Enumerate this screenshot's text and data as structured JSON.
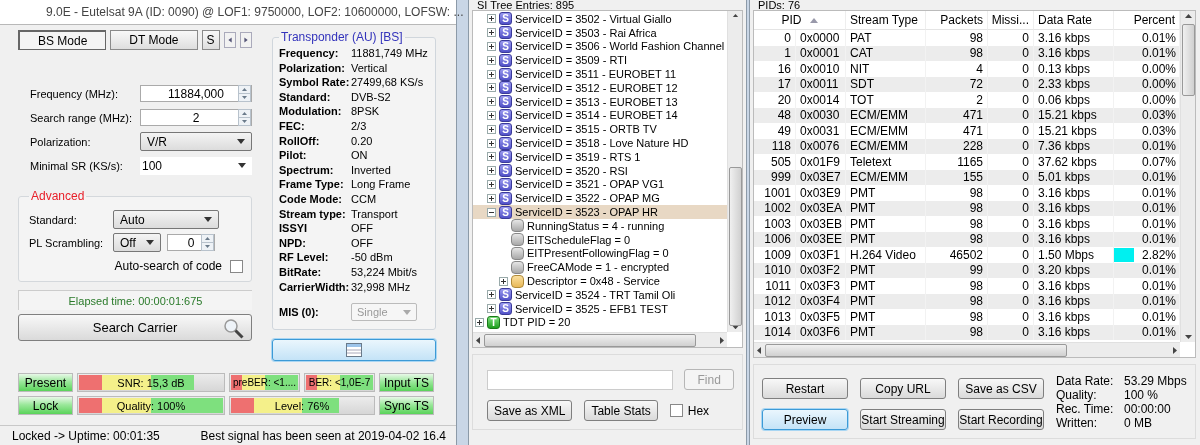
{
  "header": {
    "title": "9.0E - Eutelsat 9A (ID: 0090) @ LOF1: 9750000, LOF2: 10600000, LOFSW: ..."
  },
  "mode_tabs": [
    {
      "label": "BS Mode",
      "selected": true
    },
    {
      "label": "DT Mode",
      "selected": false
    },
    {
      "label": "S",
      "selected": false
    }
  ],
  "tuning_fields": [
    {
      "kind": "spin",
      "label": "Frequency (MHz):",
      "value": "11884,000"
    },
    {
      "kind": "spin",
      "label": "Search range (MHz):",
      "value": "2"
    },
    {
      "kind": "dropdown",
      "label": "Polarization:",
      "value": "V/R"
    },
    {
      "kind": "combo",
      "label": "Minimal SR (KS/s):",
      "value": "100"
    }
  ],
  "advanced": {
    "title": "Advanced",
    "standard": {
      "label": "Standard:",
      "value": "Auto"
    },
    "pl_scrambling": {
      "label": "PL Scrambling:",
      "mode": "Off",
      "code": "0"
    },
    "auto_search": {
      "label": "Auto-search of code",
      "checked": false
    }
  },
  "elapsed": "Elapsed time: 00:00:01:675",
  "search_button": {
    "label": "Search Carrier"
  },
  "transponder": {
    "title": "Transponder (AU) [BS]",
    "rows": [
      {
        "label": "Frequency:",
        "value": "11881,749 MHz"
      },
      {
        "label": "Polarization:",
        "value": "Vertical"
      },
      {
        "label": "Symbol Rate:",
        "value": "27499,68 KS/s"
      },
      {
        "label": "Standard:",
        "value": "DVB-S2"
      },
      {
        "label": "Modulation:",
        "value": "8PSK"
      },
      {
        "label": "FEC:",
        "value": "2/3"
      },
      {
        "label": "RollOff:",
        "value": "0.20"
      },
      {
        "label": "Pilot:",
        "value": "ON"
      },
      {
        "label": "Spectrum:",
        "value": "Inverted"
      },
      {
        "label": "Frame Type:",
        "value": "Long Frame"
      },
      {
        "label": "Code Mode:",
        "value": "CCM"
      },
      {
        "label": "Stream type:",
        "value": "Transport"
      },
      {
        "label": "ISSYI",
        "value": "OFF"
      },
      {
        "label": "NPD:",
        "value": "OFF"
      },
      {
        "label": "RF Level:",
        "value": "-50 dBm"
      },
      {
        "label": "BitRate:",
        "value": "53,224 Mbit/s"
      },
      {
        "label": "CarrierWidth:",
        "value": "32,998 MHz"
      }
    ],
    "mis": {
      "label": "MIS (0):",
      "value": "Single",
      "disabled": true
    }
  },
  "list_button": {
    "focused": true
  },
  "signal_rows": [
    [
      {
        "kind": "indicator",
        "label": "Present",
        "on": true
      },
      {
        "kind": "meter",
        "label": "SNR: 15,3 dB",
        "level": 0.8
      },
      {
        "kind": "meter",
        "label": "preBER: <1....",
        "level": 1
      },
      {
        "kind": "meter",
        "label": "BER: <1,0E-7",
        "level": 1
      },
      {
        "kind": "indicator",
        "label": "Input TS",
        "on": true
      }
    ],
    [
      {
        "kind": "indicator",
        "label": "Lock",
        "on": true
      },
      {
        "kind": "meter",
        "label": "Quality: 100%",
        "level": 1
      },
      {
        "kind": "meter",
        "label": "Level: 76%",
        "level": 0.76
      },
      {
        "kind": "indicator",
        "label": "Sync TS",
        "on": true
      }
    ]
  ],
  "status_bar": {
    "left": "Locked -> Uptime: 00:01:35",
    "right": "Best signal has been seen at 2019-04-02 16.4"
  },
  "si_tree": {
    "title": "SI Tree Entries: 895",
    "continued_branch": [
      {
        "kind": "service",
        "icon_text": "S",
        "label": "ServiceID = 3502 - Virtual Giallo",
        "expanded": false,
        "selected": false
      },
      {
        "kind": "service",
        "icon_text": "S",
        "label": "ServiceID = 3503 - Rai Africa",
        "expanded": false,
        "selected": false
      },
      {
        "kind": "service",
        "icon_text": "S",
        "label": "ServiceID = 3506 - World Fashion Channel",
        "expanded": false,
        "selected": false
      },
      {
        "kind": "service",
        "icon_text": "S",
        "label": "ServiceID = 3509 - RTI",
        "expanded": false,
        "selected": false
      },
      {
        "kind": "service",
        "icon_text": "S",
        "label": "ServiceID = 3511 - EUROBET 11",
        "expanded": false,
        "selected": false
      },
      {
        "kind": "service",
        "icon_text": "S",
        "label": "ServiceID = 3512 - EUROBET 12",
        "expanded": false,
        "selected": false
      },
      {
        "kind": "service",
        "icon_text": "S",
        "label": "ServiceID = 3513 - EUROBET 13",
        "expanded": false,
        "selected": false
      },
      {
        "kind": "service",
        "icon_text": "S",
        "label": "ServiceID = 3514 - EUROBET 14",
        "expanded": false,
        "selected": false
      },
      {
        "kind": "service",
        "icon_text": "S",
        "label": "ServiceID = 3515 - ORTB TV",
        "expanded": false,
        "selected": false
      },
      {
        "kind": "service",
        "icon_text": "S",
        "label": "ServiceID = 3518 - Love Nature HD",
        "expanded": false,
        "selected": false
      },
      {
        "kind": "service",
        "icon_text": "S",
        "label": "ServiceID = 3519 - RTS 1",
        "expanded": false,
        "selected": false
      },
      {
        "kind": "service",
        "icon_text": "S",
        "label": "ServiceID = 3520 - RSI",
        "expanded": false,
        "selected": false
      },
      {
        "kind": "service",
        "icon_text": "S",
        "label": "ServiceID = 3521 - OPAP VG1",
        "expanded": false,
        "selected": false
      },
      {
        "kind": "service",
        "icon_text": "S",
        "label": "ServiceID = 3522 - OPAP MG",
        "expanded": false,
        "selected": false
      },
      {
        "kind": "service",
        "icon_text": "S",
        "label": "ServiceID = 3523 - OPAP HR",
        "expanded": true,
        "selected": true,
        "children": [
          {
            "kind": "property",
            "label": "RunningStatus = 4 - running",
            "selected": false
          },
          {
            "kind": "property",
            "label": "EITScheduleFlag = 0",
            "selected": false
          },
          {
            "kind": "property",
            "label": "EITPresentFollowingFlag = 0",
            "selected": false
          },
          {
            "kind": "property",
            "label": "FreeCAMode = 1 - encrypted",
            "selected": false
          },
          {
            "kind": "descriptor",
            "label": "Descriptor = 0x48 - Service",
            "expanded": false,
            "selected": false
          }
        ]
      },
      {
        "kind": "service",
        "icon_text": "S",
        "label": "ServiceID = 3524 - TRT Tamil Oli",
        "expanded": false,
        "selected": false
      },
      {
        "kind": "service",
        "icon_text": "S",
        "label": "ServiceID = 3525 - EFB1 TEST",
        "expanded": false,
        "selected": false
      }
    ],
    "items": [
      {
        "kind": "table",
        "icon_text": "T",
        "label": "TDT PID = 20",
        "expanded": false,
        "selected": false
      }
    ],
    "find_button": {
      "label": "Find",
      "disabled": true
    },
    "buttons": [
      "Save as XML",
      "Table Stats"
    ],
    "hex": {
      "label": "Hex",
      "checked": false
    }
  },
  "pids": {
    "title": "PIDs: 76",
    "columns": [
      "PID",
      "Stream Type",
      "Packets",
      "Missi...",
      "Data Rate",
      "Percent"
    ],
    "rows": [
      {
        "pid": "0",
        "hex": "0x0000",
        "type": "PAT",
        "packets": "98",
        "missing": "0",
        "rate": "3.16 kbps",
        "percent": "0.01%"
      },
      {
        "pid": "1",
        "hex": "0x0001",
        "type": "CAT",
        "packets": "98",
        "missing": "0",
        "rate": "3.16 kbps",
        "percent": "0.01%"
      },
      {
        "pid": "16",
        "hex": "0x0010",
        "type": "NIT",
        "packets": "4",
        "missing": "0",
        "rate": "0.13 kbps",
        "percent": "0.00%"
      },
      {
        "pid": "17",
        "hex": "0x0011",
        "type": "SDT",
        "packets": "72",
        "missing": "0",
        "rate": "2.33 kbps",
        "percent": "0.00%"
      },
      {
        "pid": "20",
        "hex": "0x0014",
        "type": "TOT",
        "packets": "2",
        "missing": "0",
        "rate": "0.06 kbps",
        "percent": "0.00%"
      },
      {
        "pid": "48",
        "hex": "0x0030",
        "type": "ECM/EMM",
        "packets": "471",
        "missing": "0",
        "rate": "15.21 kbps",
        "percent": "0.03%"
      },
      {
        "pid": "49",
        "hex": "0x0031",
        "type": "ECM/EMM",
        "packets": "471",
        "missing": "0",
        "rate": "15.21 kbps",
        "percent": "0.03%"
      },
      {
        "pid": "118",
        "hex": "0x0076",
        "type": "ECM/EMM",
        "packets": "228",
        "missing": "0",
        "rate": "7.36 kbps",
        "percent": "0.01%"
      },
      {
        "pid": "505",
        "hex": "0x01F9",
        "type": "Teletext",
        "packets": "1165",
        "missing": "0",
        "rate": "37.62 kbps",
        "percent": "0.07%"
      },
      {
        "pid": "999",
        "hex": "0x03E7",
        "type": "ECM/EMM",
        "packets": "155",
        "missing": "0",
        "rate": "5.01 kbps",
        "percent": "0.01%"
      },
      {
        "pid": "1001",
        "hex": "0x03E9",
        "type": "PMT",
        "packets": "98",
        "missing": "0",
        "rate": "3.16 kbps",
        "percent": "0.01%"
      },
      {
        "pid": "1002",
        "hex": "0x03EA",
        "type": "PMT",
        "packets": "98",
        "missing": "0",
        "rate": "3.16 kbps",
        "percent": "0.01%"
      },
      {
        "pid": "1003",
        "hex": "0x03EB",
        "type": "PMT",
        "packets": "98",
        "missing": "0",
        "rate": "3.16 kbps",
        "percent": "0.01%"
      },
      {
        "pid": "1006",
        "hex": "0x03EE",
        "type": "PMT",
        "packets": "98",
        "missing": "0",
        "rate": "3.16 kbps",
        "percent": "0.01%"
      },
      {
        "pid": "1009",
        "hex": "0x03F1",
        "type": "H.264 Video",
        "packets": "46502",
        "missing": "0",
        "rate": "1.50 Mbps",
        "percent": "2.82%",
        "level": 0.3
      },
      {
        "pid": "1010",
        "hex": "0x03F2",
        "type": "PMT",
        "packets": "99",
        "missing": "0",
        "rate": "3.20 kbps",
        "percent": "0.01%"
      },
      {
        "pid": "1011",
        "hex": "0x03F3",
        "type": "PMT",
        "packets": "98",
        "missing": "0",
        "rate": "3.16 kbps",
        "percent": "0.01%"
      },
      {
        "pid": "1012",
        "hex": "0x03F4",
        "type": "PMT",
        "packets": "98",
        "missing": "0",
        "rate": "3.16 kbps",
        "percent": "0.01%"
      },
      {
        "pid": "1013",
        "hex": "0x03F5",
        "type": "PMT",
        "packets": "98",
        "missing": "0",
        "rate": "3.16 kbps",
        "percent": "0.01%"
      },
      {
        "pid": "1014",
        "hex": "0x03F6",
        "type": "PMT",
        "packets": "98",
        "missing": "0",
        "rate": "3.16 kbps",
        "percent": "0.01%"
      }
    ],
    "buttons": [
      {
        "label": "Restart",
        "focused": false
      },
      {
        "label": "Copy URL",
        "focused": false
      },
      {
        "label": "Save as CSV",
        "focused": false
      },
      {
        "label": "Preview",
        "focused": true
      },
      {
        "label": "Start Streaming",
        "focused": false
      },
      {
        "label": "Start Recording",
        "focused": false
      }
    ],
    "stats": [
      {
        "label": "Data Rate:",
        "value": "53.29 Mbps"
      },
      {
        "label": "Quality:",
        "value": "100 %"
      },
      {
        "label": "Rec. Time:",
        "value": "00:00:00"
      },
      {
        "label": "Written:",
        "value": "0 MB"
      }
    ]
  }
}
